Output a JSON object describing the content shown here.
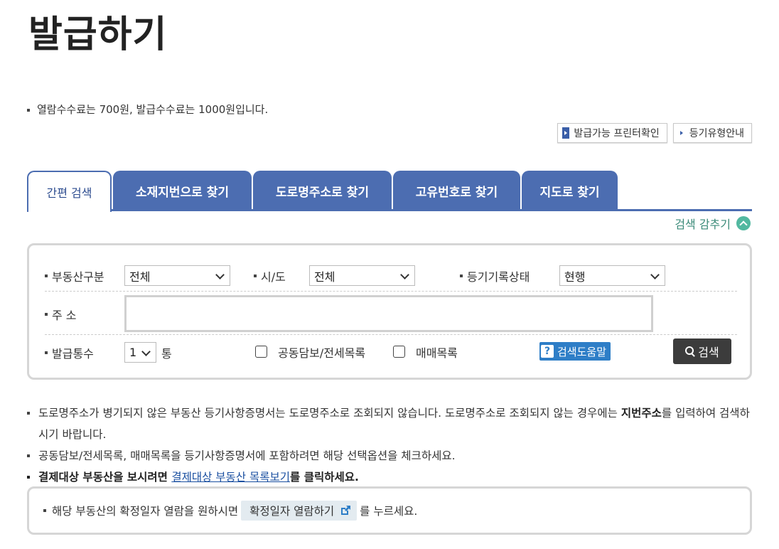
{
  "page": {
    "title": "발급하기",
    "fee_notice": "열람수수료는 700원, 발급수수료는 1000원입니다."
  },
  "top_buttons": {
    "printer_check": "발급가능 프린터확인",
    "registry_type_guide": "등기유형안내"
  },
  "tabs": [
    {
      "label": "간편 검색",
      "active": true
    },
    {
      "label": "소재지번으로 찾기",
      "active": false
    },
    {
      "label": "도로명주소로 찾기",
      "active": false
    },
    {
      "label": "고유번호로 찾기",
      "active": false
    },
    {
      "label": "지도로 찾기",
      "active": false
    }
  ],
  "hide_search": "검색 감추기",
  "search_form": {
    "property_type_label": "부동산구분",
    "property_type_value": "전체",
    "sido_label": "시/도",
    "sido_value": "전체",
    "record_status_label": "등기기록상태",
    "record_status_value": "현행",
    "address_label": "주 소",
    "address_value": "",
    "copies_label": "발급통수",
    "copies_value": "1",
    "copies_unit": "통",
    "mortgage_list_label": "공동담보/전세목록",
    "mortgage_list_checked": false,
    "sales_list_label": "매매목록",
    "sales_list_checked": false,
    "help_label": "검색도움말",
    "search_label": "검색"
  },
  "notes": {
    "note1_a": "도로명주소가 병기되지 않은 부동산 등기사항증명서는 도로명주소로 조회되지 않습니다. 도로명주소로 조회되지 않는 경우에는 ",
    "note1_b": "지번주소",
    "note1_c": "를 입력하여 검색하시기 바랍니다.",
    "note2": "공동담보/전세목록, 매매목록을 등기사항증명서에 포함하려면 해당 선택옵션을 체크하세요.",
    "note3_a": "결제대상 부동산을 보시려면 ",
    "note3_link": "결제대상 부동산 목록보기",
    "note3_b": "를 클릭하세요."
  },
  "confirm_box": {
    "text_before": "해당 부동산의 확정일자 열람을 원하시면",
    "button_label": "확정일자 열람하기",
    "text_after": "를 누르세요."
  },
  "colors": {
    "tab_blue": "#4c6db1",
    "hide_search_green": "#3a8a78",
    "help_blue": "#2e7ec7",
    "search_dark": "#3c3c3c"
  }
}
